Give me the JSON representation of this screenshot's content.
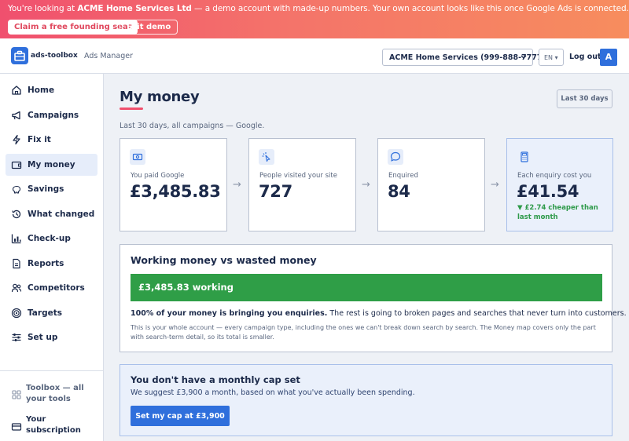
{
  "banner": {
    "prefix": "You're looking at ",
    "account": "ACME Home Services Ltd",
    "suffix": " — a demo account with made-up numbers. Your own account looks like this once Google Ads is connected.",
    "claim_label": "Claim a free founding seat",
    "exit_label": "Exit demo"
  },
  "topnav": {
    "logo_text": "ads-toolbox",
    "product": "Ads Manager",
    "account_selected": "ACME Home Services (999-888-7777)",
    "language": "EN",
    "logout_label": "Log out",
    "avatar_initial": "A"
  },
  "sidebar": {
    "items": [
      {
        "label": "Home",
        "icon": "home-icon"
      },
      {
        "label": "Campaigns",
        "icon": "megaphone-icon"
      },
      {
        "label": "Fix it",
        "icon": "bolt-icon"
      },
      {
        "label": "My money",
        "icon": "wallet-icon"
      },
      {
        "label": "Savings",
        "icon": "piggy-bank-icon"
      },
      {
        "label": "What changed",
        "icon": "history-icon"
      },
      {
        "label": "Check-up",
        "icon": "bar-chart-icon"
      },
      {
        "label": "Reports",
        "icon": "document-icon"
      },
      {
        "label": "Competitors",
        "icon": "users-icon"
      },
      {
        "label": "Targets",
        "icon": "target-icon"
      },
      {
        "label": "Set up",
        "icon": "sliders-icon"
      }
    ],
    "active": "My money",
    "toolbox_label": "Toolbox — all your tools",
    "subscription_label": "Your subscription"
  },
  "main": {
    "title": "My money",
    "date_range": "Last 30 days",
    "subtitle": "Last 30 days, all campaigns — Google.",
    "cards": [
      {
        "label": "You paid Google",
        "value": "£3,485.83",
        "icon": "money-icon"
      },
      {
        "label": "People visited your site",
        "value": "727",
        "icon": "cursor-click-icon"
      },
      {
        "label": "Enquired",
        "value": "84",
        "icon": "chat-icon"
      },
      {
        "label": "Each enquiry cost you",
        "value": "£41.54",
        "icon": "calculator-icon",
        "note": "▼ £2.74 cheaper than last month"
      }
    ],
    "working_panel": {
      "title": "Working money vs wasted money",
      "bar_label": "£3,485.83 working",
      "working_fraction": 1.0,
      "bold_text": "100% of your money is bringing you enquiries.",
      "rest_text": " The rest is going to broken pages and searches that never turn into customers.",
      "small_text": "This is your whole account — every campaign type, including the ones we can't break down search by search. The Money map covers only the part with search-term detail, so its total is smaller."
    },
    "cap_panel": {
      "title": "You don't have a monthly cap set",
      "subtitle": "We suggest £3,900 a month, based on what you've actually been spending.",
      "button_label": "Set my cap at £3,900"
    }
  },
  "colors": {
    "accent": "#2f6fdc",
    "banner_start": "#f0506e",
    "banner_end": "#f78d5e",
    "working_green": "#2f9e47",
    "positive_green": "#2e9a4a"
  }
}
